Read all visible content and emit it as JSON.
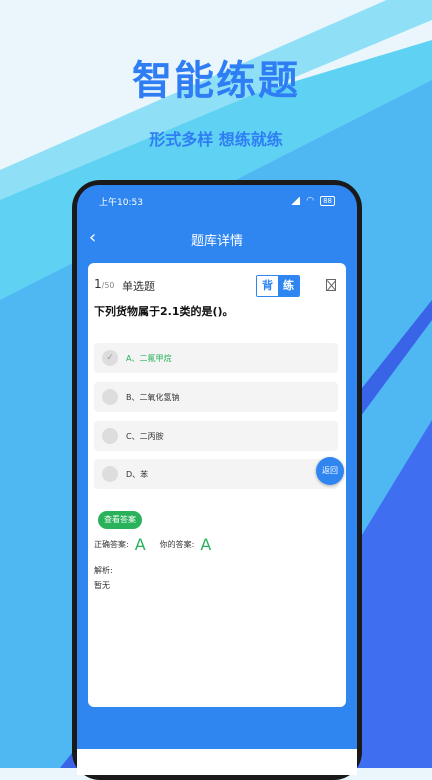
{
  "promo": {
    "title": "智能练题",
    "subtitle": "形式多样 想练就练"
  },
  "colors": {
    "primary_blue": "#2f86f1",
    "headline_blue": "#2f7df4",
    "correct_green": "#29b25a",
    "bg_light": "#eaf6fb",
    "bg_cyan": "#5fd2f3",
    "bg_deep_blue": "#3f6ff0"
  },
  "statusbar": {
    "time": "上午10:53",
    "battery": "88"
  },
  "navbar": {
    "back_icon": "chevron-left-icon",
    "title": "题库详情"
  },
  "question": {
    "index": "1",
    "total": "/50",
    "type": "单选题",
    "mode_recite": "背",
    "mode_practice": "练",
    "text": "下列货物属于2.1类的是()。",
    "options": [
      {
        "label": "A、二氟甲烷",
        "selected": true
      },
      {
        "label": "B、二氧化氢钠",
        "selected": false
      },
      {
        "label": "C、二丙胺",
        "selected": false
      },
      {
        "label": "D、苯",
        "selected": false
      }
    ]
  },
  "return_button": "返回",
  "answer": {
    "check_button": "查看答案",
    "correct_label": "正确答案:",
    "correct_value": "A",
    "your_label": "你的答案:",
    "your_value": "A",
    "analysis_label": "解析:",
    "analysis_text": "暂无"
  }
}
